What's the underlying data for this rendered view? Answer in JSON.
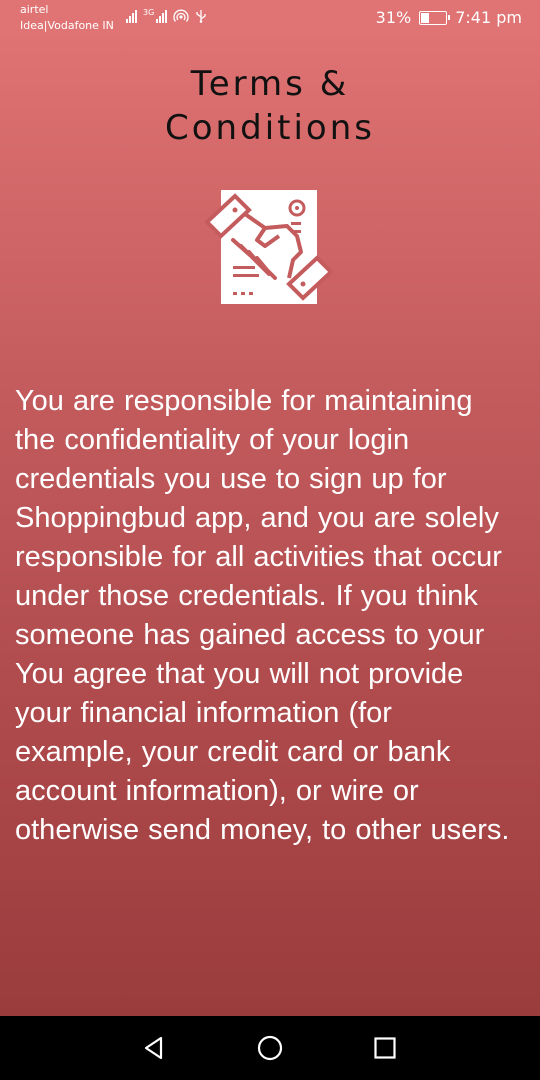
{
  "status_bar": {
    "carrier_primary": "airtel",
    "carrier_secondary": "Idea|Vodafone IN",
    "network_label": "3G",
    "battery_level": 0.31,
    "battery_text": "31%",
    "time": "7:41 pm"
  },
  "page": {
    "title_line1": "Terms &",
    "title_line2": "Conditions",
    "icon": "handshake-agreement-icon",
    "body": "You are responsible for maintaining the confidentiality of your login credentials you use to sign up for Shoppingbud app, and you are solely responsible for all activities that occur under those credentials. If you think someone has gained access to your   You agree that you will not provide your financial information (for example, your credit card or bank account information), or wire or otherwise send money, to other users."
  },
  "nav_bar": {
    "back_icon": "back-triangle-icon",
    "home_icon": "home-circle-icon",
    "recents_icon": "recents-square-icon"
  },
  "colors": {
    "status_bar": "#e07474",
    "gradient_top": "#e27474",
    "gradient_bottom": "#963939",
    "title_text": "#111111",
    "body_text": "#ffffff"
  }
}
